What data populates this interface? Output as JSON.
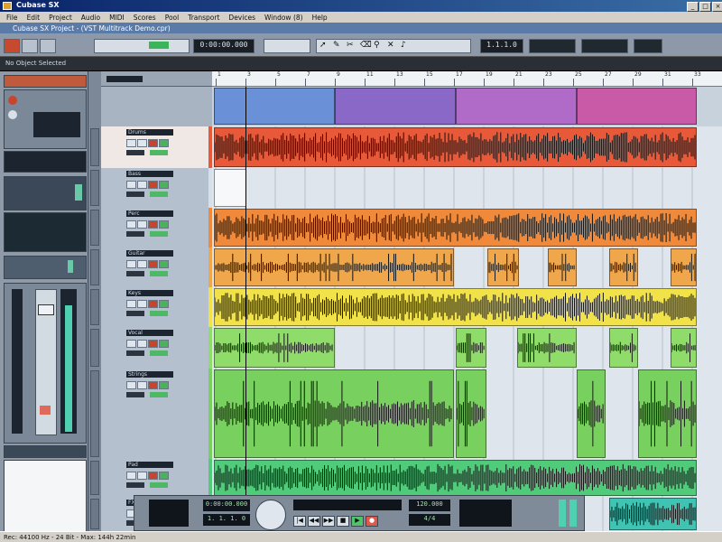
{
  "window": {
    "title": "Cubase SX"
  },
  "menu": [
    "File",
    "Edit",
    "Project",
    "Audio",
    "MIDI",
    "Scores",
    "Pool",
    "Transport",
    "Devices",
    "Window (8)",
    "Help"
  ],
  "project_window": {
    "title": "Cubase SX Project - (VST Multitrack Demo.cpr)"
  },
  "toolbar": {
    "displays": [
      "0:00:00.000",
      "1.1.1.0"
    ]
  },
  "info_line": {
    "label": "No Object Selected"
  },
  "ruler": {
    "marks": [
      "1",
      "3",
      "5",
      "7",
      "9",
      "11",
      "13",
      "15",
      "17",
      "19",
      "21",
      "23",
      "25",
      "27",
      "29",
      "31",
      "33"
    ]
  },
  "tracks": [
    {
      "name": "Drums",
      "color": "#e8593a",
      "type": "audio"
    },
    {
      "name": "Bass",
      "color": "#d7e0ea",
      "type": "empty"
    },
    {
      "name": "Perc",
      "color": "#f08a3a",
      "type": "audio"
    },
    {
      "name": "Guitar",
      "color": "#f0a64a",
      "type": "audio"
    },
    {
      "name": "Keys",
      "color": "#f2e24a",
      "type": "audio"
    },
    {
      "name": "Vocal",
      "color": "#8fdc6a",
      "type": "audio"
    },
    {
      "name": "Strings",
      "color": "#78d05e",
      "type": "audio"
    },
    {
      "name": "Pad",
      "color": "#4fcb7a",
      "type": "audio"
    },
    {
      "name": "FX",
      "color": "#3fc4b4",
      "type": "audio"
    }
  ],
  "transport": {
    "position": "0:00:00.000",
    "bars": "1. 1. 1. 0",
    "tempo": "120.000",
    "signature": "4/4",
    "buttons": [
      "|◀",
      "◀◀",
      "▶▶",
      "■",
      "▶",
      "●"
    ]
  },
  "statusbar": {
    "text": "Rec: 44100 Hz - 24 Bit - Max: 144h 22min"
  }
}
